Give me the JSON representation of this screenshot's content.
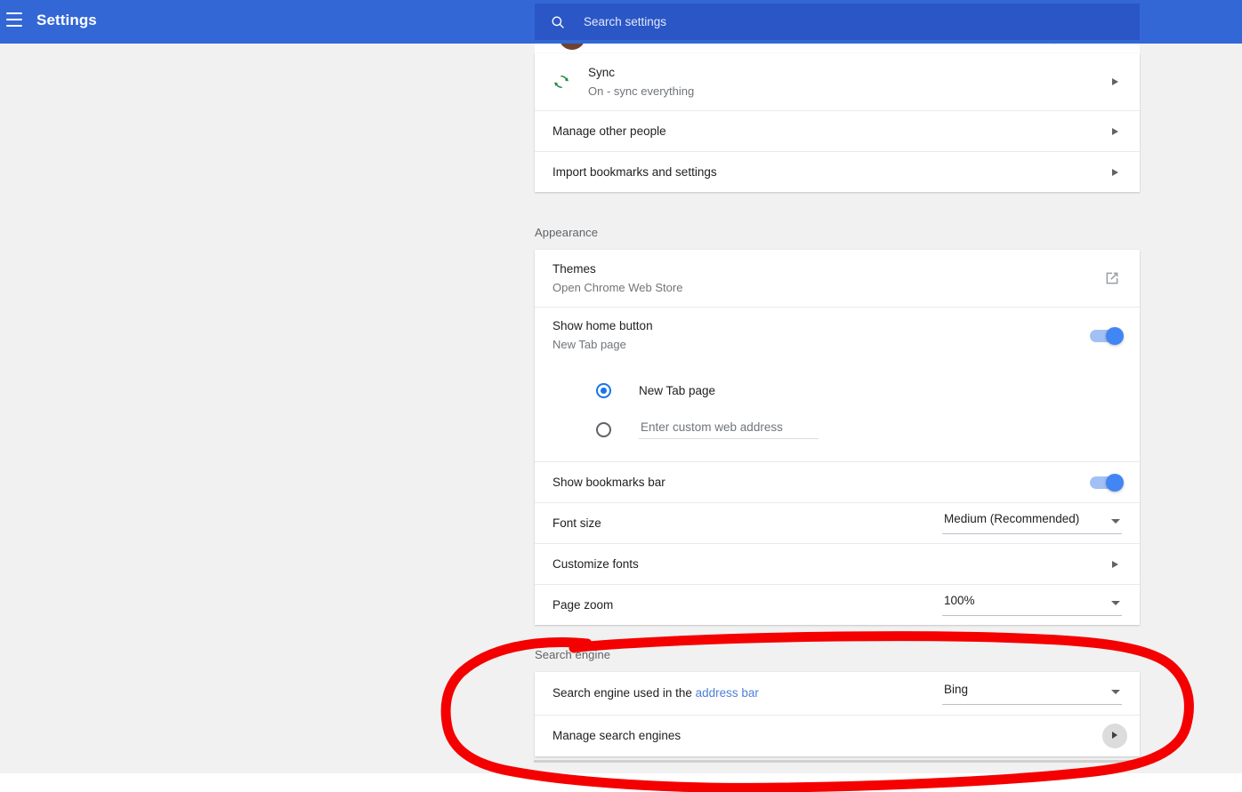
{
  "header": {
    "title": "Settings",
    "menu_icon": "hamburger-icon",
    "search": {
      "icon": "search-icon",
      "placeholder": "Search settings",
      "value": ""
    }
  },
  "colors": {
    "topbar": "#3367d6",
    "searchbox": "#2a56c6",
    "page_background": "#f1f1f1",
    "card": "#ffffff",
    "accent": "#4285f4",
    "link": "#4e7fd8",
    "sync_icon": "#1e8e3e",
    "annotation": "#f40000"
  },
  "people_card": {
    "partial_row_note": "",
    "rows": [
      {
        "title": "Sync",
        "subtitle": "On - sync everything",
        "icon": "sync-icon",
        "trailing": "chevron-right-icon"
      },
      {
        "title": "Manage other people",
        "subtitle": "",
        "trailing": "chevron-right-icon"
      },
      {
        "title": "Import bookmarks and settings",
        "subtitle": "",
        "trailing": "chevron-right-icon"
      }
    ]
  },
  "appearance": {
    "section_label": "Appearance",
    "themes": {
      "title": "Themes",
      "subtitle": "Open Chrome Web Store",
      "trailing": "external-link-icon"
    },
    "show_home_button": {
      "title": "Show home button",
      "subtitle": "New Tab page",
      "toggle_on": true
    },
    "home_options": [
      {
        "label": "New Tab page",
        "selected": true
      },
      {
        "label": "",
        "placeholder": "Enter custom web address",
        "value": "",
        "selected": false
      }
    ],
    "show_bookmarks_bar": {
      "title": "Show bookmarks bar",
      "toggle_on": true
    },
    "font_size": {
      "title": "Font size",
      "value": "Medium (Recommended)"
    },
    "customize_fonts": {
      "title": "Customize fonts",
      "trailing": "chevron-right-icon"
    },
    "page_zoom": {
      "title": "Page zoom",
      "value": "100%"
    }
  },
  "search_engine": {
    "section_label": "Search engine",
    "address_bar_row": {
      "title_prefix": "Search engine used in the ",
      "title_link": "address bar",
      "value": "Bing"
    },
    "manage_row": {
      "title": "Manage search engines",
      "trailing": "chevron-right-icon"
    }
  },
  "annotation": {
    "shape": "hand-drawn-ellipse",
    "color": "#f40000",
    "target": "Search engine"
  }
}
